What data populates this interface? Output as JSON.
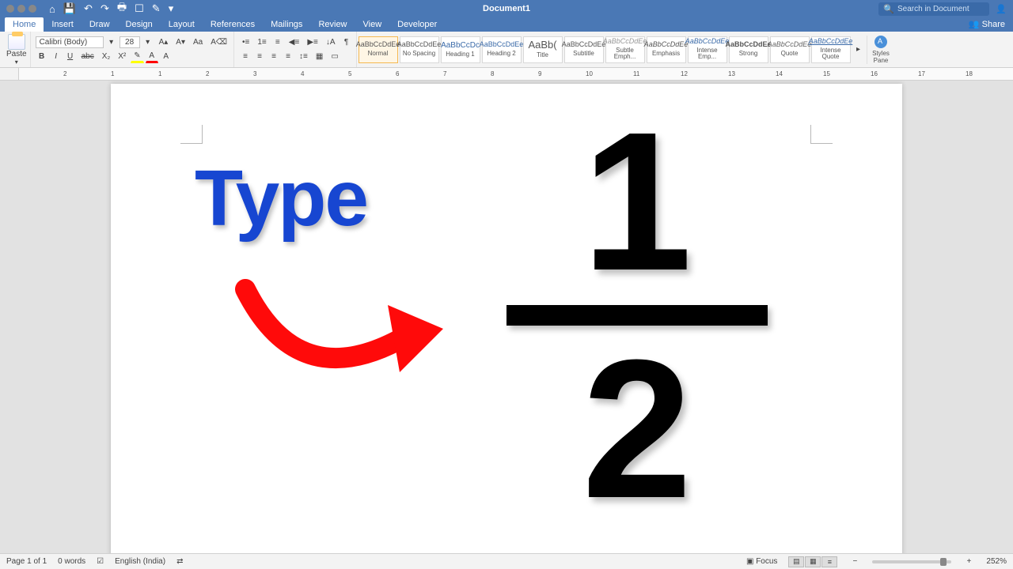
{
  "titlebar": {
    "doc_title": "Document1",
    "search_placeholder": "Search in Document",
    "share_label": "Share"
  },
  "tabs": [
    "Home",
    "Insert",
    "Draw",
    "Design",
    "Layout",
    "References",
    "Mailings",
    "Review",
    "View",
    "Developer"
  ],
  "active_tab": "Home",
  "ribbon": {
    "paste_label": "Paste",
    "font_name": "Calibri (Body)",
    "font_size": "28",
    "styles": [
      {
        "preview": "AaBbCcDdEe",
        "name": "Normal",
        "sel": true
      },
      {
        "preview": "AaBbCcDdEe",
        "name": "No Spacing"
      },
      {
        "preview": "AaBbCcDc",
        "name": "Heading 1"
      },
      {
        "preview": "AaBbCcDdEe",
        "name": "Heading 2"
      },
      {
        "preview": "AaBb(",
        "name": "Title"
      },
      {
        "preview": "AaBbCcDdEe",
        "name": "Subtitle"
      },
      {
        "preview": "AaBbCcDdEe",
        "name": "Subtle Emph..."
      },
      {
        "preview": "AaBbCcDdEe",
        "name": "Emphasis"
      },
      {
        "preview": "AaBbCcDdEe",
        "name": "Intense Emp..."
      },
      {
        "preview": "AaBbCcDdEe",
        "name": "Strong"
      },
      {
        "preview": "AaBbCcDdEe",
        "name": "Quote"
      },
      {
        "preview": "AaBbCcDdEe",
        "name": "Intense Quote"
      }
    ],
    "styles_pane": "Styles Pane"
  },
  "ruler_numbers": [
    2,
    1,
    1,
    2,
    3,
    4,
    5,
    6,
    7,
    8,
    9,
    10,
    11,
    12,
    13,
    14,
    15,
    16,
    17,
    18
  ],
  "content": {
    "type_label": "Type",
    "numerator": "1",
    "denominator": "2"
  },
  "statusbar": {
    "page": "Page 1 of 1",
    "words": "0 words",
    "language": "English (India)",
    "focus": "Focus",
    "zoom": "252%"
  }
}
